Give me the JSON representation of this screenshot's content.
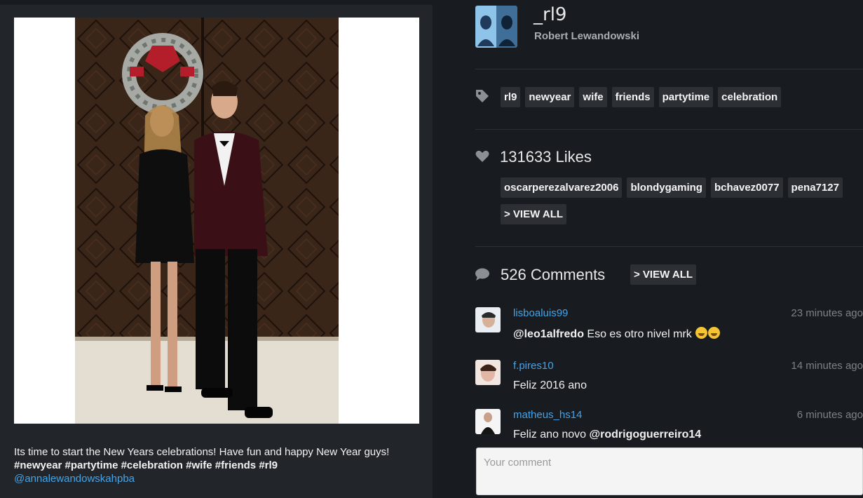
{
  "post": {
    "caption_text": "Its time to start the New Years celebrations! Have fun and happy New Year guys!",
    "caption_tags": "#newyear #partytime #celebration #wife #friends #rl9",
    "caption_mention": "@annalewandowskahpba"
  },
  "profile": {
    "username": "_rl9",
    "full_name": "Robert Lewandowski"
  },
  "tags": [
    "rl9",
    "newyear",
    "wife",
    "friends",
    "partytime",
    "celebration"
  ],
  "likes": {
    "count_text": "131633 Likes",
    "likers": [
      "oscarperezalvarez2006",
      "blondygaming",
      "bchavez0077",
      "pena7127"
    ],
    "view_all_label": "> VIEW ALL"
  },
  "comments": {
    "count_text": "526 Comments",
    "view_all_label": "> VIEW ALL",
    "items": [
      {
        "user": "lisboaluis99",
        "time": "23 minutes ago",
        "mention": "@leo1alfredo",
        "text": " Eso es otro nivel mrk "
      },
      {
        "user": "f.pires10",
        "time": "14 minutes ago",
        "mention": "",
        "text": "Feliz 2016 ano"
      },
      {
        "user": "matheus_hs14",
        "time": "6 minutes ago",
        "mention": "@rodrigoguerreiro14",
        "text": "Feliz ano novo "
      }
    ],
    "input_placeholder": "Your comment"
  },
  "colors": {
    "background": "#181c20",
    "card": "#22262a",
    "chip": "#2c3034",
    "link": "#46a3e6"
  }
}
